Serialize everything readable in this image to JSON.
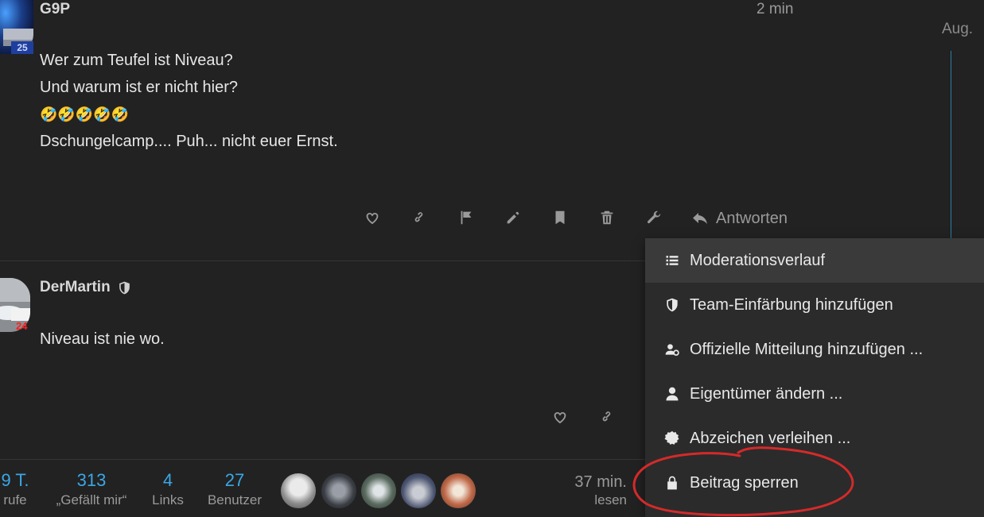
{
  "posts": [
    {
      "username": "G9P",
      "avatar_badge": "25",
      "time": "2 min",
      "lines": [
        "Wer zum Teufel ist Niveau?",
        "Und warum ist er nicht hier?",
        "🤣🤣🤣🤣🤣",
        "Dschungelcamp.... Puh... nicht euer Ernst."
      ],
      "reply_label": "Antworten"
    },
    {
      "username": "DerMartin",
      "avatar_badge": "24",
      "lines": [
        "Niveau ist nie wo."
      ]
    }
  ],
  "timeline": {
    "date_label": "Aug."
  },
  "menu": {
    "items": [
      {
        "label": "Moderationsverlauf",
        "icon": "list-icon"
      },
      {
        "label": "Team-Einfärbung hinzufügen",
        "icon": "shield-icon"
      },
      {
        "label": "Offizielle Mitteilung hinzufügen ...",
        "icon": "user-official-icon"
      },
      {
        "label": "Eigentümer ändern ...",
        "icon": "user-icon"
      },
      {
        "label": "Abzeichen verleihen ...",
        "icon": "badge-certificate-icon"
      },
      {
        "label": "Beitrag sperren",
        "icon": "lock-icon"
      }
    ]
  },
  "summary": {
    "stats": [
      {
        "num": "9 T.",
        "lbl": "rufe"
      },
      {
        "num": "313",
        "lbl": "„Gefällt mir“"
      },
      {
        "num": "4",
        "lbl": "Links"
      },
      {
        "num": "27",
        "lbl": "Benutzer"
      }
    ],
    "read_time_num": "37 min.",
    "read_time_lbl": "lesen"
  },
  "colors": {
    "background": "#222222",
    "accent": "#3aa7e6",
    "annotation": "#d42a2a",
    "muted": "#9a9a9a"
  }
}
